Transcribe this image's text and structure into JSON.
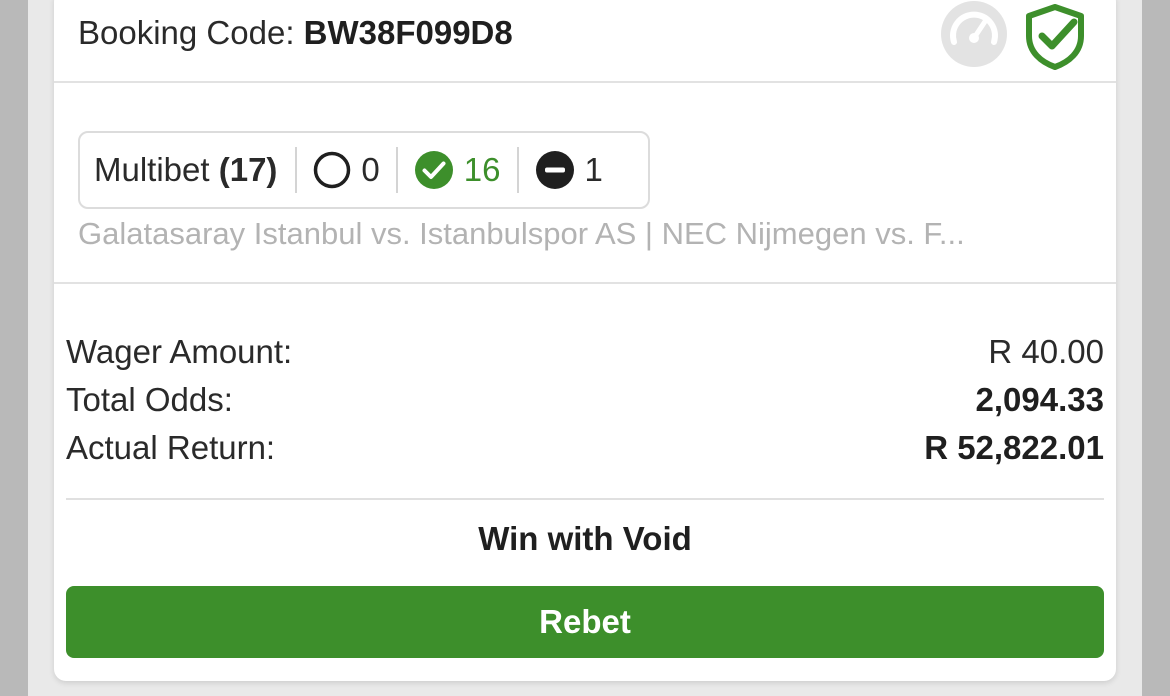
{
  "booking": {
    "label": "Booking Code:",
    "code": "BW38F099D8",
    "icons": [
      "speedometer-icon",
      "shield-check-icon"
    ]
  },
  "multibet": {
    "label": "Multibet",
    "count": "(17)",
    "open_count": "0",
    "won_count": "16",
    "void_count": "1"
  },
  "events_summary": "Galatasaray Istanbul vs. Istanbulspor AS | NEC Nijmegen vs. F...",
  "totals": {
    "wager_label": "Wager Amount:",
    "wager_value": "R 40.00",
    "odds_label": "Total Odds:",
    "odds_value": "2,094.33",
    "return_label": "Actual Return:",
    "return_value": "R 52,822.01"
  },
  "status_text": "Win with Void",
  "rebet_label": "Rebet",
  "colors": {
    "accent_green": "#3d8f2b",
    "muted_gray": "#b3b3b3"
  }
}
